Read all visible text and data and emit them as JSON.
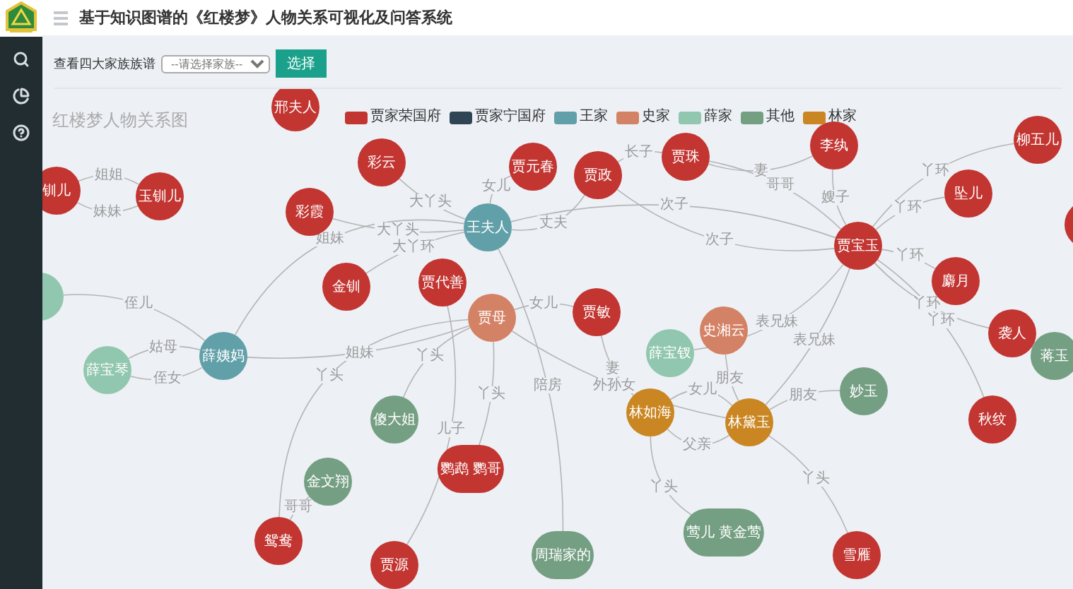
{
  "header": {
    "title": "基于知识图谱的《红楼梦》人物关系可视化及问答系统"
  },
  "filter": {
    "label": "查看四大家族族谱",
    "select": {
      "placeholder": "--请选择家族--"
    },
    "button": "选择"
  },
  "chart": {
    "title": "红楼梦人物关系图",
    "legend": [
      {
        "label": "贾家荣国府",
        "color": "#c23531"
      },
      {
        "label": "贾家宁国府",
        "color": "#2f4554"
      },
      {
        "label": "王家",
        "color": "#61a0a8"
      },
      {
        "label": "史家",
        "color": "#d48265"
      },
      {
        "label": "薛家",
        "color": "#91c7ae"
      },
      {
        "label": "其他",
        "color": "#749f83"
      },
      {
        "label": "林家",
        "color": "#ca8622"
      }
    ],
    "nodes": [
      {
        "name": "邢夫人",
        "color": "#c23531"
      },
      {
        "name": "钏儿",
        "color": "#c23531"
      },
      {
        "name": "玉钏儿",
        "color": "#c23531"
      },
      {
        "name": "彩云",
        "color": "#c23531"
      },
      {
        "name": "彩霞",
        "color": "#c23531"
      },
      {
        "name": "金钏",
        "color": "#c23531"
      },
      {
        "name": "王夫人",
        "color": "#61a0a8"
      },
      {
        "name": "贾元春",
        "color": "#c23531"
      },
      {
        "name": "贾政",
        "color": "#c23531"
      },
      {
        "name": "贾珠",
        "color": "#c23531"
      },
      {
        "name": "李纨",
        "color": "#c23531"
      },
      {
        "name": "贾宝玉",
        "color": "#c23531"
      },
      {
        "name": "柳五儿",
        "color": "#c23531"
      },
      {
        "name": "坠儿",
        "color": "#c23531"
      },
      {
        "color": "#c23531"
      },
      {
        "name": "麝月",
        "color": "#c23531"
      },
      {
        "name": "袭人",
        "color": "#c23531"
      },
      {
        "name": "蒋玉",
        "color": "#749f83"
      },
      {
        "name": "秋纹",
        "color": "#c23531"
      },
      {
        "name": "妙玉",
        "color": "#749f83"
      },
      {
        "name": "史湘云",
        "color": "#d48265"
      },
      {
        "name": "薛宝钗",
        "color": "#91c7ae"
      },
      {
        "name": "林如海",
        "color": "#ca8622"
      },
      {
        "name": "林黛玉",
        "color": "#ca8622"
      },
      {
        "name": "贾敏",
        "color": "#c23531"
      },
      {
        "name": "贾代善",
        "color": "#c23531"
      },
      {
        "name": "贾母",
        "color": "#d48265"
      },
      {
        "name": "薛姨妈",
        "color": "#61a0a8"
      },
      {
        "name": "薛宝琴",
        "color": "#91c7ae"
      },
      {
        "color": "#91c7ae"
      },
      {
        "name": "傻大姐",
        "color": "#749f83"
      },
      {
        "name": "金文翔",
        "color": "#749f83"
      },
      {
        "name": "鸳鸯",
        "color": "#c23531"
      },
      {
        "name": "贾源",
        "color": "#c23531"
      },
      {
        "name": "鹦鹉 鹦哥",
        "color": "#c23531"
      },
      {
        "name": "周瑞家的",
        "color": "#749f83"
      },
      {
        "name": "莺儿 黄金莺",
        "color": "#749f83"
      },
      {
        "name": "雪雁",
        "color": "#c23531"
      }
    ],
    "relations": [
      {
        "label": "姐姐"
      },
      {
        "label": "妹妹"
      },
      {
        "label": "大丫头"
      },
      {
        "label": "大丫头"
      },
      {
        "label": "大丫环"
      },
      {
        "label": "姐妹"
      },
      {
        "label": "姐妹"
      },
      {
        "label": "侄女"
      },
      {
        "label": "姑母"
      },
      {
        "label": "侄儿"
      },
      {
        "label": "女儿"
      },
      {
        "label": "丈夫"
      },
      {
        "label": "长子"
      },
      {
        "label": "妻"
      },
      {
        "label": "次子"
      },
      {
        "label": "次子"
      },
      {
        "label": "哥哥"
      },
      {
        "label": "嫂子"
      },
      {
        "label": "丫环"
      },
      {
        "label": "丫环"
      },
      {
        "label": "丫环"
      },
      {
        "label": "丫环"
      },
      {
        "label": "丫环"
      },
      {
        "label": "表兄妹"
      },
      {
        "label": "表兄妹"
      },
      {
        "label": "朋友"
      },
      {
        "label": "父亲"
      },
      {
        "label": "女儿"
      },
      {
        "label": "妻"
      },
      {
        "label": "女儿"
      },
      {
        "label": "外孙女"
      },
      {
        "label": "丫头"
      },
      {
        "label": "哥哥"
      },
      {
        "label": "丫头"
      },
      {
        "label": "丫头"
      },
      {
        "label": "儿子"
      },
      {
        "label": "朋友"
      },
      {
        "label": "丫头"
      },
      {
        "label": "丫头"
      },
      {
        "label": "陪房"
      }
    ]
  }
}
